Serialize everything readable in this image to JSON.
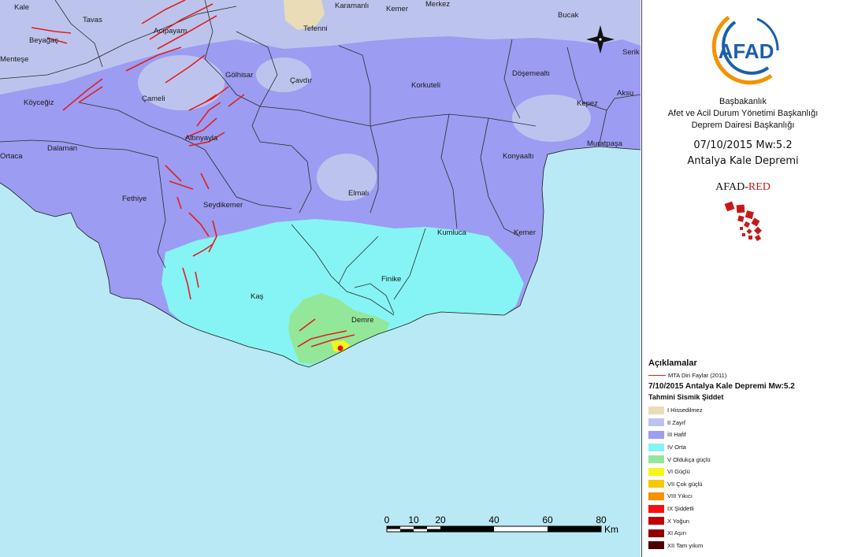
{
  "places": [
    {
      "id": "kale",
      "name": "Kale"
    },
    {
      "id": "tavas",
      "name": "Tavas"
    },
    {
      "id": "karamanli",
      "name": "Karamanlı"
    },
    {
      "id": "kemer_n",
      "name": "Kemer"
    },
    {
      "id": "merkez",
      "name": "Merkez"
    },
    {
      "id": "bucak",
      "name": "Bucak"
    },
    {
      "id": "beyagac",
      "name": "Beyağaç"
    },
    {
      "id": "acipayam",
      "name": "Acıpayam"
    },
    {
      "id": "tefenni",
      "name": "Tefenni"
    },
    {
      "id": "serik",
      "name": "Serik"
    },
    {
      "id": "mentese",
      "name": "Menteşe"
    },
    {
      "id": "golhisar",
      "name": "Gölhisar"
    },
    {
      "id": "cavdir",
      "name": "Çavdır"
    },
    {
      "id": "korkuteli",
      "name": "Korkuteli"
    },
    {
      "id": "dosemealti",
      "name": "Döşemealtı"
    },
    {
      "id": "aksu",
      "name": "Aksu"
    },
    {
      "id": "koycegiz",
      "name": "Köyceğiz"
    },
    {
      "id": "cameli",
      "name": "Çameli"
    },
    {
      "id": "kepez",
      "name": "Kepez"
    },
    {
      "id": "altinyayla",
      "name": "Altınyayla"
    },
    {
      "id": "dalaman",
      "name": "Dalaman"
    },
    {
      "id": "muratpasa",
      "name": "Muratpaşa"
    },
    {
      "id": "konyaalti",
      "name": "Konyaaltı"
    },
    {
      "id": "ortaca",
      "name": "Ortaca"
    },
    {
      "id": "elmali",
      "name": "Elmalı"
    },
    {
      "id": "fethiye",
      "name": "Fethiye"
    },
    {
      "id": "seydikemer",
      "name": "Seydikemer"
    },
    {
      "id": "kumluca",
      "name": "Kumluca"
    },
    {
      "id": "kemer_s",
      "name": "Kemer"
    },
    {
      "id": "finike",
      "name": "Finike"
    },
    {
      "id": "kas",
      "name": "Kaş"
    },
    {
      "id": "demre",
      "name": "Demre"
    }
  ],
  "scale_bar": {
    "ticks": [
      "0",
      "10",
      "20",
      "40",
      "60",
      "80"
    ],
    "unit": "Km"
  },
  "colors": {
    "sea": "#b9e9f4",
    "int_1": "#eadcb6",
    "int_2": "#bcc4ee",
    "int_3": "#9c9cf2",
    "int_4": "#86f4f4",
    "int_5": "#92e898",
    "int_6": "#f6f61a",
    "fault": "#e02020",
    "epicenter": "#e81010"
  },
  "logo": {
    "text": "AFAD"
  },
  "institution": {
    "line1": "Başbakanlık",
    "line2": "Afet ve Acil Durum Yönetimi Başkanlığı",
    "line3": "Deprem Dairesi Başkanlığı"
  },
  "event": {
    "line1": "07/10/2015 Mw:5.2",
    "line2": "Antalya Kale Depremi"
  },
  "afad_red": {
    "part1": "AFAD-",
    "part2": "RED"
  },
  "legend": {
    "title": "Açıklamalar",
    "fault_label": "MTA Diri Faylar (2011)",
    "quake_title": "7/10/2015 Antalya Kale Depremi Mw:5.2",
    "intensity_title": "Tahmini Sismik Şiddet",
    "items": [
      {
        "label": "I Hissedilmez",
        "color": "#eadcb6"
      },
      {
        "label": "II Zayıf",
        "color": "#bcc4ee"
      },
      {
        "label": "İII Hafif",
        "color": "#9c9cf2"
      },
      {
        "label": "IV Orta",
        "color": "#86f4f4"
      },
      {
        "label": "V Oldukça güçlü",
        "color": "#92e898"
      },
      {
        "label": "VI Güçlü",
        "color": "#f6f61a"
      },
      {
        "label": "VII Çok güçlü",
        "color": "#f8c800"
      },
      {
        "label": "VIII Yıkıcı",
        "color": "#f89000"
      },
      {
        "label": "IX Şiddetli",
        "color": "#f81010"
      },
      {
        "label": "X Yoğun",
        "color": "#c00000"
      },
      {
        "label": "XI Aşırı",
        "color": "#900000"
      },
      {
        "label": "XII Tam yıkım",
        "color": "#500000"
      }
    ]
  }
}
